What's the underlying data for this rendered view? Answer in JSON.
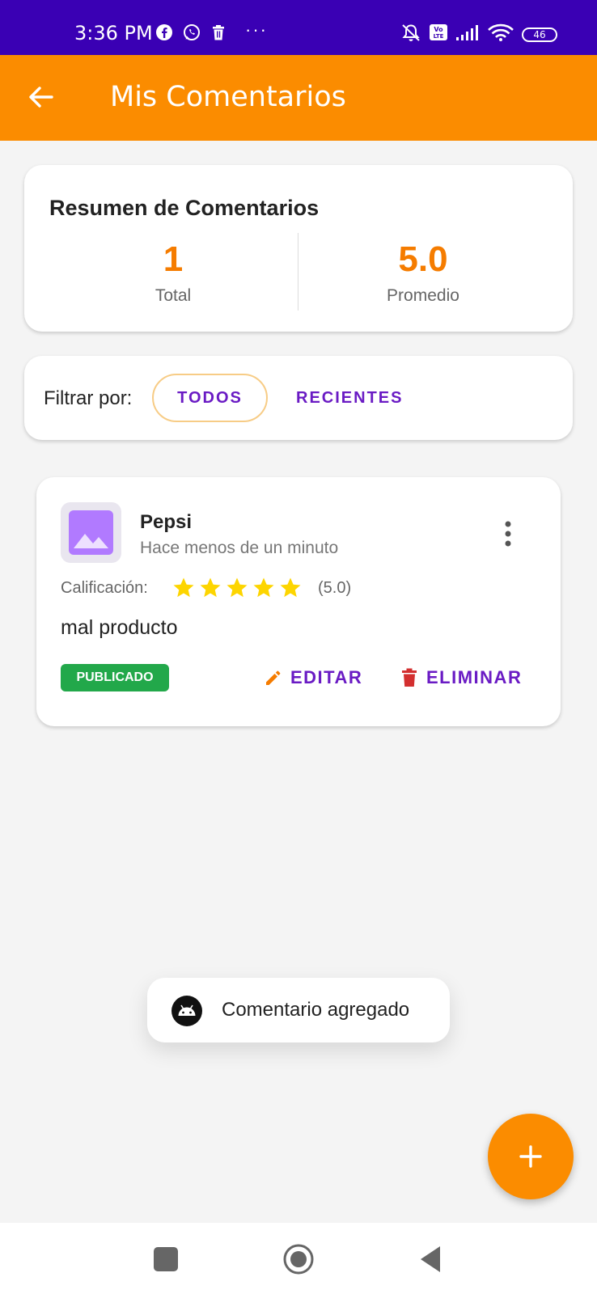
{
  "status_bar": {
    "time": "3:36 PM",
    "battery": "46",
    "icons": [
      "facebook-icon",
      "whatsapp-icon",
      "trash-icon",
      "more-dots",
      "mute-icon",
      "volte-icon",
      "signal-icon",
      "wifi-icon",
      "battery-icon"
    ],
    "more": "···"
  },
  "app_bar": {
    "title": "Mis Comentarios",
    "color": "#fb8c00"
  },
  "summary": {
    "title": "Resumen de Comentarios",
    "total_value": "1",
    "total_label": "Total",
    "average_value": "5.0",
    "average_label": "Promedio",
    "accent": "#f57c00"
  },
  "filter": {
    "label": "Filtrar por:",
    "options": [
      "TODOS",
      "RECIENTES"
    ],
    "selected": "TODOS"
  },
  "comments": [
    {
      "product": "Pepsi",
      "time_ago": "Hace menos de un minuto",
      "rating_label": "Calificación:",
      "stars": 5,
      "rating_text": "(5.0)",
      "text": "mal producto",
      "status": "PUBLICADO",
      "edit_label": "EDITAR",
      "delete_label": "ELIMINAR"
    }
  ],
  "toast": {
    "message": "Comentario agregado"
  },
  "fab": {
    "icon": "plus-icon"
  },
  "nav": {
    "icons": [
      "recent-apps-icon",
      "home-icon",
      "back-icon"
    ]
  }
}
